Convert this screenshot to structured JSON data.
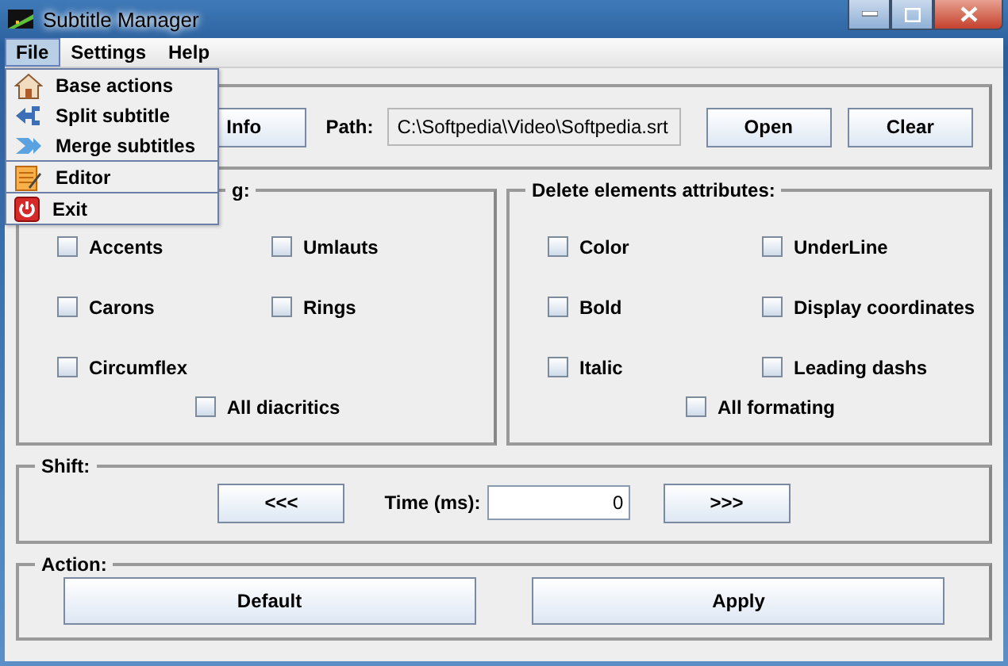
{
  "window": {
    "title": "Subtitle Manager"
  },
  "menu_bar": [
    {
      "label": "File",
      "selected": true
    },
    {
      "label": "Settings",
      "selected": false
    },
    {
      "label": "Help",
      "selected": false
    }
  ],
  "file_menu": [
    [
      {
        "label": "Base actions",
        "kind": "house"
      },
      {
        "label": "Split subtitle",
        "kind": "split"
      },
      {
        "label": "Merge subtitles",
        "kind": "merge"
      }
    ],
    [
      {
        "label": "Editor",
        "kind": "editor"
      }
    ],
    [
      {
        "label": "Exit",
        "kind": "exit"
      }
    ]
  ],
  "file_panel": {
    "info_button": "Info",
    "path_label": "Path:",
    "path_value": "C:\\Softpedia\\Video\\Softpedia.srt",
    "buttons": [
      "Open",
      "Clear"
    ]
  },
  "diacritics_panel": {
    "title": "g:",
    "options": [
      {
        "label": "Accents",
        "checked": false
      },
      {
        "label": "Umlauts",
        "checked": false
      },
      {
        "label": "Carons",
        "checked": false
      },
      {
        "label": "Rings",
        "checked": false
      },
      {
        "label": "Circumflex",
        "checked": false
      }
    ],
    "all": {
      "label": "All diacritics",
      "checked": false
    }
  },
  "attributes_panel": {
    "title": "Delete elements attributes:",
    "options": [
      {
        "label": "Color",
        "checked": false
      },
      {
        "label": "UnderLine",
        "checked": false
      },
      {
        "label": "Bold",
        "checked": false
      },
      {
        "label": "Display coordinates",
        "checked": false
      },
      {
        "label": "Italic",
        "checked": false
      },
      {
        "label": "Leading dashs",
        "checked": false
      }
    ],
    "all": {
      "label": "All formating",
      "checked": false
    }
  },
  "shift_panel": {
    "title": "Shift:",
    "back": "<<<",
    "time_label": "Time (ms):",
    "time_value": "0",
    "forward": ">>>"
  },
  "action_panel": {
    "title": "Action:",
    "buttons": [
      "Default",
      "Apply"
    ]
  }
}
